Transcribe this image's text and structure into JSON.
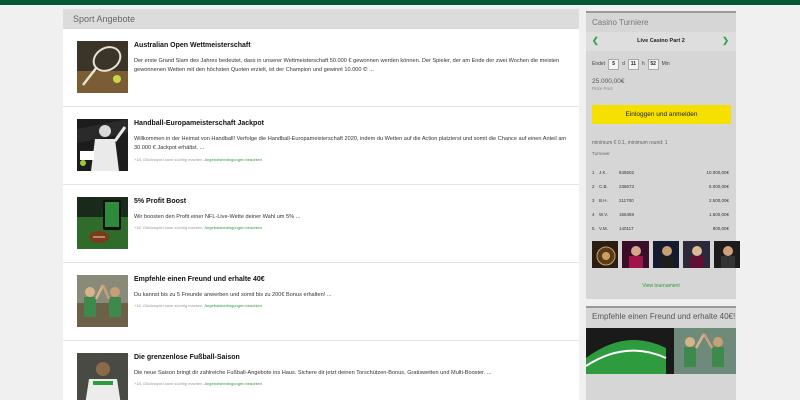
{
  "sport_section": {
    "header": "Sport Angebote",
    "promos": [
      {
        "title": "Australian Open Wettmeisterschaft",
        "description": "Der erste Grand Slam des Jahres bedeutet, dass in unserer Wettmeisterschaft 50.000 € gewonnen werden können. Der Spieler, der am Ende der zwei Wochen die meisten gewonnenen Wetten mit den höchsten Quoten erzielt, ist der Champion und gewinnt 10.000 €! ...",
        "terms_prefix": "",
        "terms_link": "",
        "thumb": "tennis-racket-image"
      },
      {
        "title": "Handball-Europameisterschaft Jackpot",
        "description": "Willkommen in der Heimat von Handball! Verfolge die Handball-Europameisterschaft 2020, indem du Wetten auf die Action platzierst und somit die Chance auf einen Anteil am 30.000 € Jackpot erhältst. ...",
        "terms_prefix": "+18. Glücksspiel kann süchtig machen.",
        "terms_link": "Angebotsbedingungen beachten",
        "thumb": "handball-player-image"
      },
      {
        "title": "5% Profit Boost",
        "description": "Wir boosten den Profit einer NFL-Live-Wette deiner Wahl um 5% ...",
        "terms_prefix": "+18. Glücksspiel kann süchtig machen.",
        "terms_link": "Angebotsbedingungen beachten",
        "thumb": "american-football-image"
      },
      {
        "title": "Empfehle einen Freund und erhalte 40€",
        "description": "Du kannst bis zu 5 Freunde anwerben und somit bis zu 200€ Bonus erhalten! ...",
        "terms_prefix": "+18. Glücksspiel kann süchtig machen.",
        "terms_link": "Angebotsbedingungen beachten",
        "thumb": "friends-high-five-image"
      },
      {
        "title": "Die grenzenlose Fußball-Saison",
        "description": "Die neue Saison bringt dir zahlreiche Fußball-Angebote ins Haus. Sichere dir jetzt deinen Torschützen-Bonus, Gratiswetten und Multi-Booster. ...",
        "terms_prefix": "+18. Glücksspiel kann süchtig machen.",
        "terms_link": "Angebotsbedingungen beachten",
        "thumb": "football-fan-image"
      }
    ]
  },
  "casino": {
    "header": "Casino Turniere",
    "tournament_name": "Live Casino Part 2",
    "ends_label": "Endet",
    "days": "5",
    "days_unit": "d",
    "hours": "11",
    "hours_unit": "h",
    "minutes": "52",
    "minutes_unit": "Min",
    "prize_pool_value": "25.000,00€",
    "prize_pool_label": "Prize Pool",
    "login_button": "Einloggen und anmelden",
    "minimum_text": "minimum € 0.1, minimum round: 1",
    "turnover_label": "Turnover",
    "leaderboard": [
      {
        "rank": "1",
        "name": "J.K.",
        "score": "845502",
        "prize": "10.000,00€"
      },
      {
        "rank": "2",
        "name": "C.B.",
        "score": "236673",
        "prize": "5.000,00€"
      },
      {
        "rank": "3",
        "name": "B.H.",
        "score": "211700",
        "prize": "2.500,00€"
      },
      {
        "rank": "4",
        "name": "W.V.",
        "score": "166459",
        "prize": "1.500,00€"
      },
      {
        "rank": "5",
        "name": "V.M.",
        "score": "140117",
        "prize": "800,00€"
      }
    ],
    "view_link": "View tournament",
    "accent_color": "#2aa14a",
    "button_color": "#f5e000"
  },
  "refer_banner": {
    "header": "Empfehle einen Freund und erhalte 40€!"
  },
  "colors": {
    "brand_green": "#035a34",
    "link_green": "#2e9b3e"
  }
}
